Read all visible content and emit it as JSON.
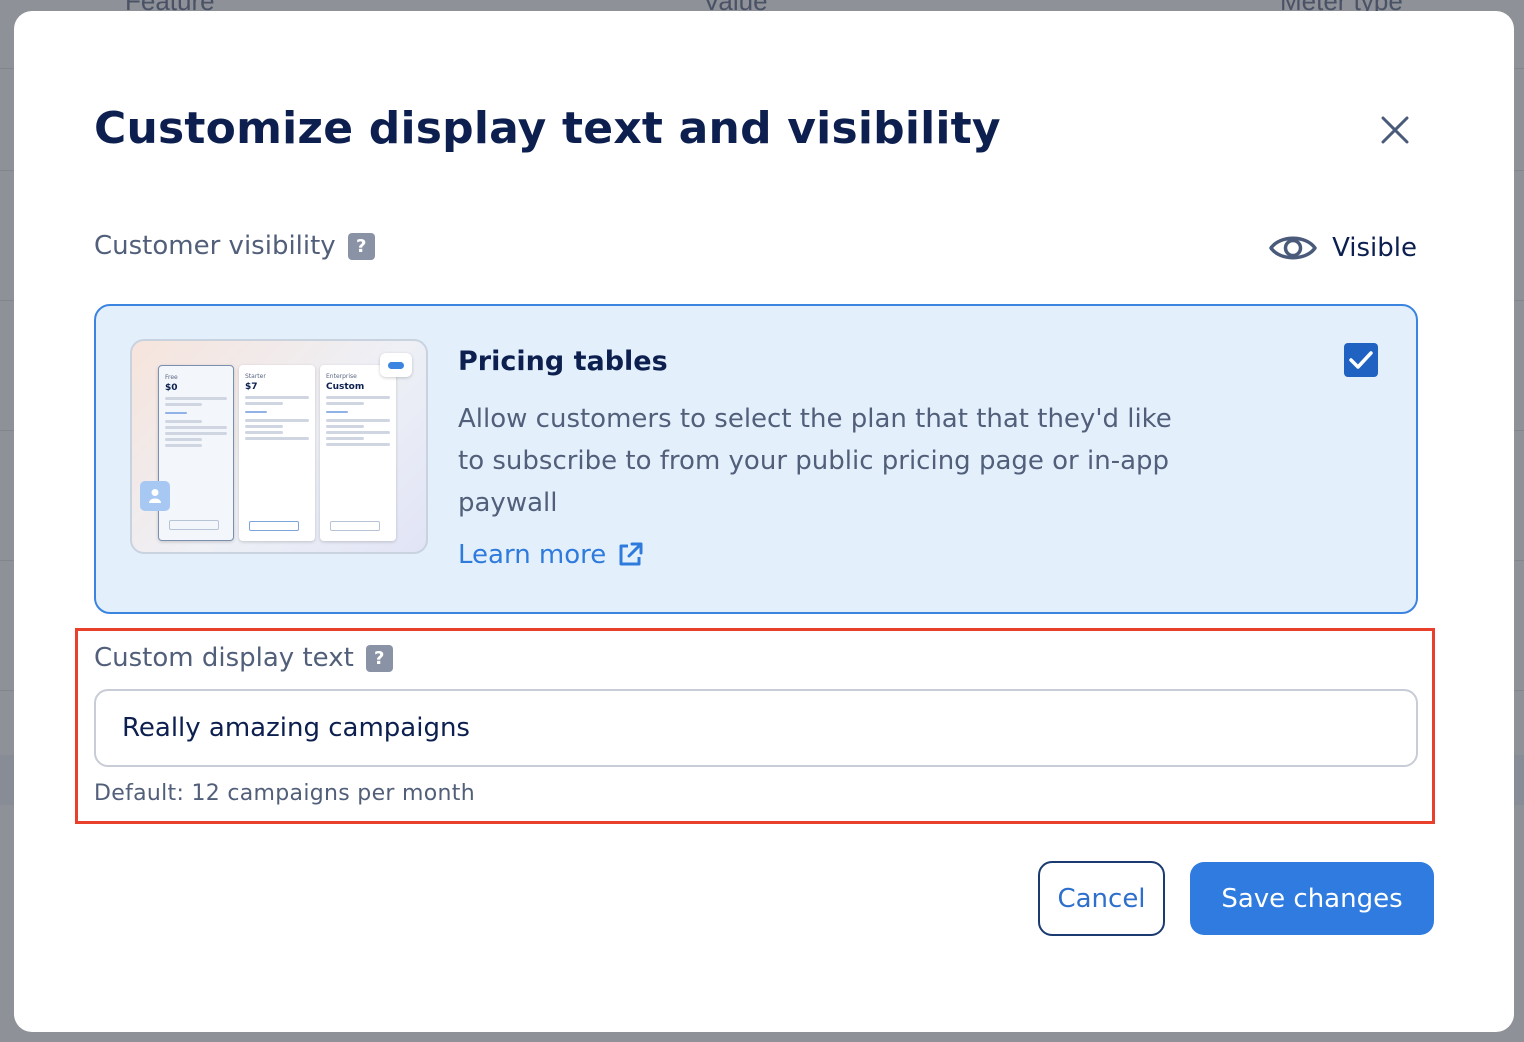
{
  "background": {
    "col1": "Feature",
    "col2": "Value",
    "col3": "Meter type"
  },
  "modal": {
    "title": "Customize display text and visibility",
    "close_icon": "close-icon"
  },
  "visibility": {
    "label": "Customer visibility",
    "help": "?",
    "status": "Visible",
    "status_icon": "eye-icon"
  },
  "pricing_card": {
    "title": "Pricing tables",
    "description": "Allow customers to select the plan that that they'd like to subscribe to from your public pricing page or in-app paywall",
    "learn_more": "Learn more",
    "checked": true,
    "preview": {
      "plans": [
        {
          "name": "Free",
          "price": "$0"
        },
        {
          "name": "Starter",
          "price": "$7"
        },
        {
          "name": "Enterprise",
          "price": "Custom"
        }
      ]
    }
  },
  "custom_text": {
    "label": "Custom display text",
    "help": "?",
    "value": "Really amazing campaigns",
    "hint": "Default: 12 campaigns per month"
  },
  "footer": {
    "cancel": "Cancel",
    "save": "Save changes"
  },
  "colors": {
    "accent": "#2f7be0",
    "highlight": "#e8402a",
    "title": "#0c1f4f"
  }
}
